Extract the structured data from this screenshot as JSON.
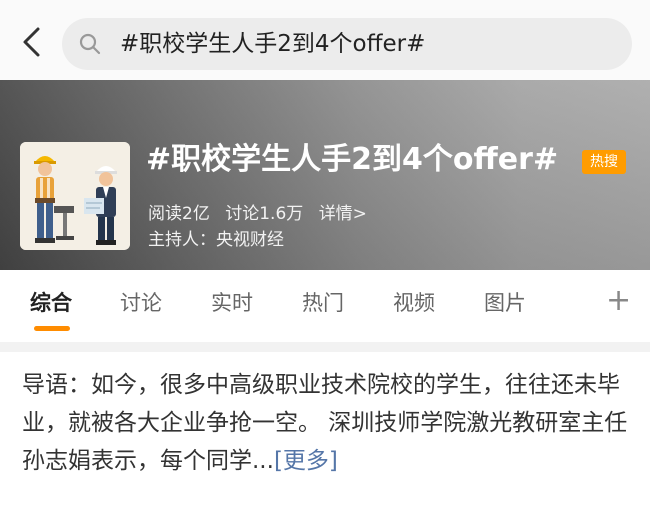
{
  "search": {
    "query": "#职校学生人手2到4个offer#"
  },
  "topic": {
    "title": "#职校学生人手2到4个offer#",
    "hot_badge": "热搜",
    "reads": "阅读2亿",
    "discussions": "讨论1.6万",
    "detail_link": "详情>",
    "host": "主持人：央视财经"
  },
  "tabs": [
    {
      "label": "综合"
    },
    {
      "label": "讨论"
    },
    {
      "label": "实时"
    },
    {
      "label": "热门"
    },
    {
      "label": "视频"
    },
    {
      "label": "图片"
    }
  ],
  "tab_plus": "+",
  "intro": {
    "text": "导语：如今，很多中高级职业技术院校的学生，往往还未毕业，就被各大企业争抢一空。 深圳技师学院激光教研室主任孙志娟表示，每个同学...",
    "more_label": "[更多]"
  },
  "colors": {
    "accent": "#ff8c00",
    "hot_badge": "#ff9c00",
    "link": "#5576a8"
  }
}
